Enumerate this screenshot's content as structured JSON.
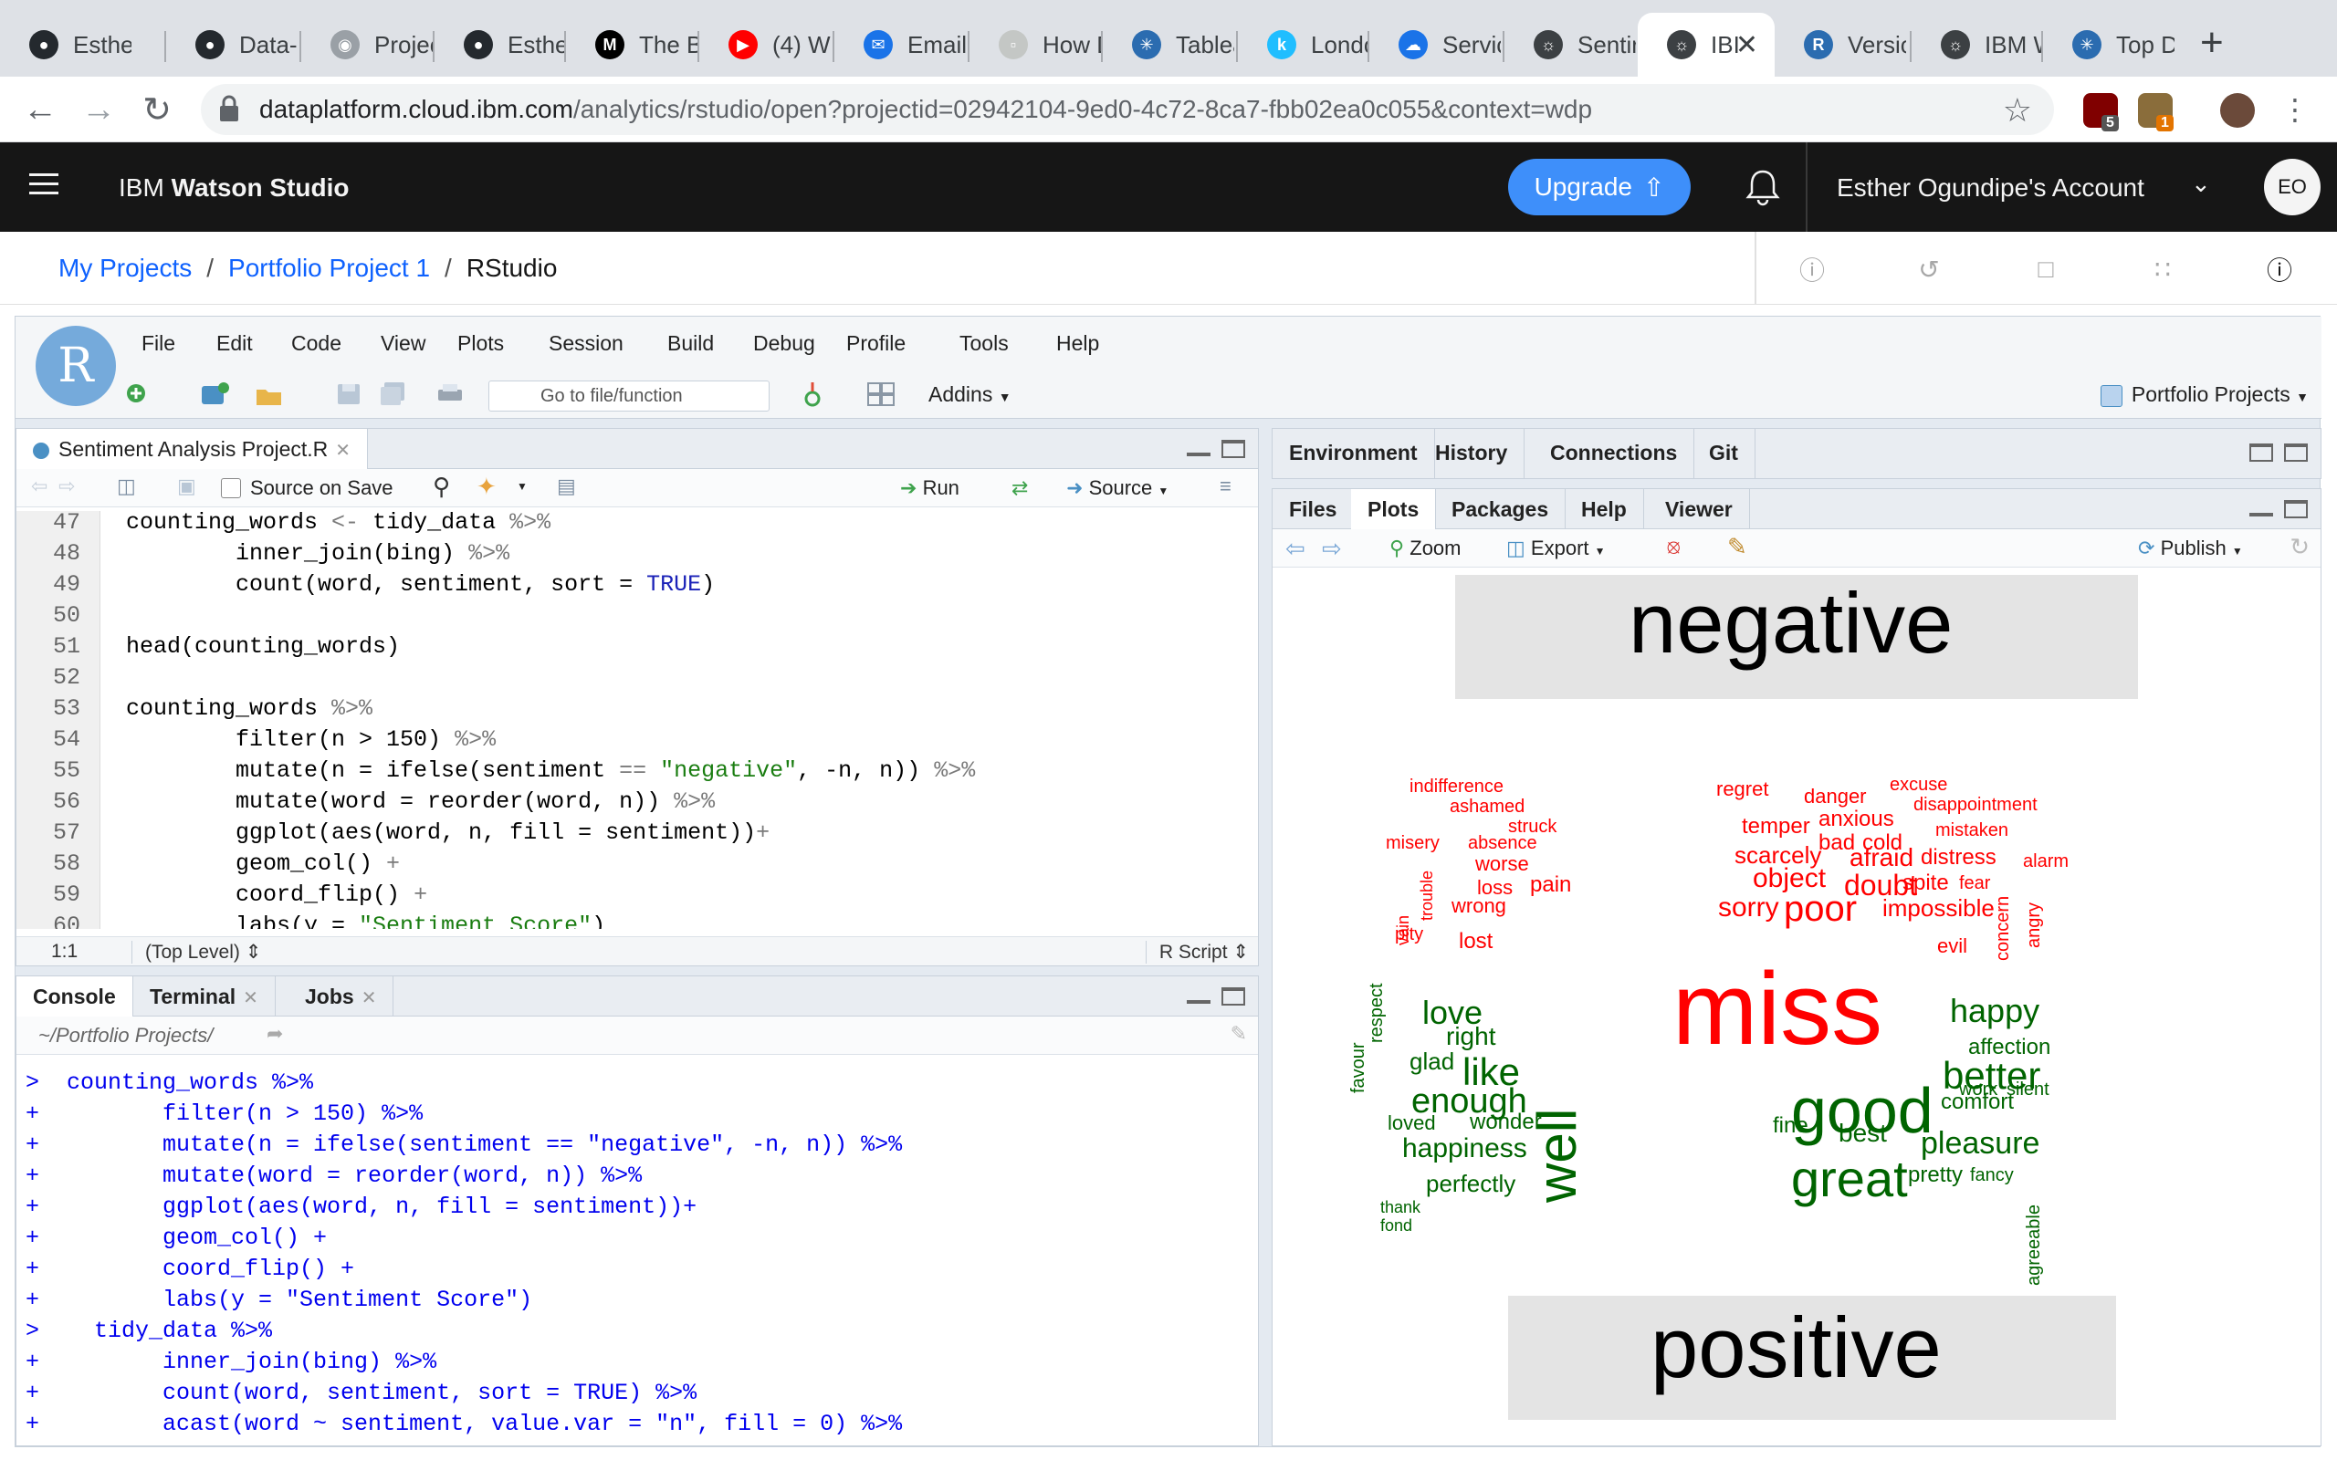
{
  "browser": {
    "tabs": [
      {
        "title": "Esther",
        "icon": "github-icon"
      },
      {
        "title": "Data-",
        "icon": "github-icon"
      },
      {
        "title": "Projec",
        "icon": "globe-icon"
      },
      {
        "title": "Esther",
        "icon": "github-icon"
      },
      {
        "title": "The B",
        "icon": "medium-icon"
      },
      {
        "title": "(4) W",
        "icon": "youtube-icon"
      },
      {
        "title": "Email",
        "icon": "mail-icon"
      },
      {
        "title": "How D",
        "icon": "page-icon"
      },
      {
        "title": "Tablea",
        "icon": "tableau-icon"
      },
      {
        "title": "Londo",
        "icon": "kaggle-icon"
      },
      {
        "title": "Servic",
        "icon": "cloud-icon"
      },
      {
        "title": "Sentir",
        "icon": "watson-icon"
      },
      {
        "title": "IBI",
        "icon": "watson-icon",
        "active": true
      },
      {
        "title": "Versio",
        "icon": "r-icon"
      },
      {
        "title": "IBM W",
        "icon": "watson-icon"
      },
      {
        "title": "Top D",
        "icon": "tableau-icon"
      }
    ],
    "url_host": "dataplatform.cloud.ibm.com",
    "url_path": "/analytics/rstudio/open?projectid=02942104-9ed0-4c72-8ca7-fbb02ea0c055&context=wdp",
    "ext_badges": [
      "5",
      "1"
    ]
  },
  "watson": {
    "brand_prefix": "IBM",
    "brand_name": "Watson Studio",
    "upgrade_label": "Upgrade",
    "account_label": "Esther Ogundipe's Account",
    "avatar_initials": "EO",
    "breadcrumb": [
      "My Projects",
      "Portfolio Project 1",
      "RStudio"
    ]
  },
  "rstudio": {
    "logo": "R",
    "menu": [
      "File",
      "Edit",
      "Code",
      "View",
      "Plots",
      "Session",
      "Build",
      "Debug",
      "Profile",
      "Tools",
      "Help"
    ],
    "goto_placeholder": "Go to file/function",
    "addins_label": "Addins",
    "project_label": "Portfolio Projects",
    "editor": {
      "tab_label": "Sentiment Analysis Project.R",
      "source_on_save": "Source on Save",
      "run_label": "Run",
      "source_label": "Source",
      "lines": [
        {
          "n": "47",
          "text": "counting_words <- tidy_data %>%"
        },
        {
          "n": "48",
          "text": "        inner_join(bing) %>%"
        },
        {
          "n": "49",
          "text": "        count(word, sentiment, sort = TRUE)"
        },
        {
          "n": "50",
          "text": ""
        },
        {
          "n": "51",
          "text": "head(counting_words)"
        },
        {
          "n": "52",
          "text": ""
        },
        {
          "n": "53",
          "text": "counting_words %>%"
        },
        {
          "n": "54",
          "text": "        filter(n > 150) %>%"
        },
        {
          "n": "55",
          "text": "        mutate(n = ifelse(sentiment == \"negative\", -n, n)) %>%"
        },
        {
          "n": "56",
          "text": "        mutate(word = reorder(word, n)) %>%"
        },
        {
          "n": "57",
          "text": "        ggplot(aes(word, n, fill = sentiment))+"
        },
        {
          "n": "58",
          "text": "        geom_col() +"
        },
        {
          "n": "59",
          "text": "        coord_flip() +"
        },
        {
          "n": "60",
          "text": "        labs(y = \"Sentiment Score\")"
        }
      ],
      "cursor_pos": "1:1",
      "scope": "(Top Level)",
      "file_type": "R Script"
    },
    "console": {
      "tabs": [
        "Console",
        "Terminal",
        "Jobs"
      ],
      "path": "~/Portfolio Projects/",
      "lines": [
        ">  counting_words %>%",
        "+         filter(n > 150) %>%",
        "+         mutate(n = ifelse(sentiment == \"negative\", -n, n)) %>%",
        "+         mutate(word = reorder(word, n)) %>%",
        "+         ggplot(aes(word, n, fill = sentiment))+",
        "+         geom_col() +",
        "+         coord_flip() +",
        "+         labs(y = \"Sentiment Score\")",
        ">    tidy_data %>%",
        "+         inner_join(bing) %>%",
        "+         count(word, sentiment, sort = TRUE) %>%",
        "+         acast(word ~ sentiment, value.var = \"n\", fill = 0) %>%"
      ]
    },
    "env_tabs": [
      "Environment",
      "History",
      "Connections",
      "Git"
    ],
    "plot_tabs": [
      "Files",
      "Plots",
      "Packages",
      "Help",
      "Viewer"
    ],
    "plot_tools": {
      "zoom": "Zoom",
      "export": "Export",
      "publish": "Publish"
    },
    "wordcloud": {
      "negative_title": "negative",
      "positive_title": "positive",
      "negative_color": "#ff0000",
      "positive_color": "#006400",
      "negative_words": [
        "miss",
        "poor",
        "doubt",
        "sorry",
        "object",
        "afraid",
        "scarcely",
        "temper",
        "anxious",
        "impossible",
        "distress",
        "danger",
        "regret",
        "indifference",
        "ashamed",
        "excuse",
        "disappointment",
        "mistaken",
        "misery",
        "struck",
        "absence",
        "worse",
        "bad",
        "cold",
        "vain",
        "trouble",
        "loss",
        "pain",
        "spite",
        "fear",
        "alarm",
        "wrong",
        "pity",
        "lost",
        "concern",
        "angry",
        "evil"
      ],
      "positive_words": [
        "good",
        "well",
        "great",
        "like",
        "love",
        "happy",
        "better",
        "enough",
        "pleasure",
        "happiness",
        "best",
        "affection",
        "comfort",
        "glad",
        "right",
        "respect",
        "favour",
        "loved",
        "wonder",
        "fine",
        "work",
        "silent",
        "pretty",
        "fancy",
        "perfectly",
        "agreeable",
        "thank",
        "fond"
      ]
    }
  }
}
